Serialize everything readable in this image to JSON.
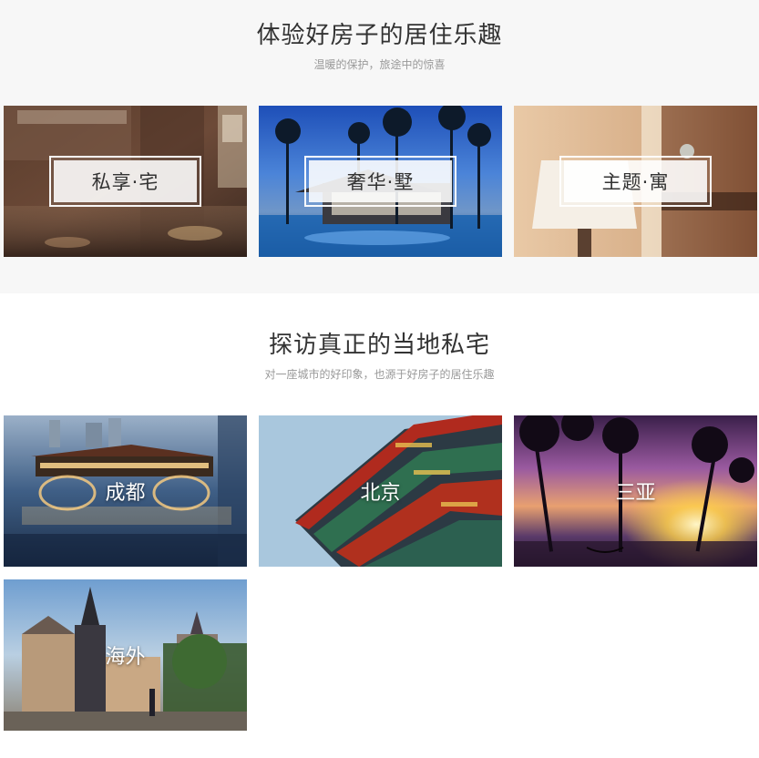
{
  "section_featured": {
    "title": "体验好房子的居住乐趣",
    "subtitle": "温暖的保护，旅途中的惊喜",
    "cards": [
      {
        "label": "私享·宅"
      },
      {
        "label": "奢华·墅"
      },
      {
        "label": "主题·寓"
      }
    ]
  },
  "section_cities": {
    "title": "探访真正的当地私宅",
    "subtitle": "对一座城市的好印象，也源于好房子的居住乐趣",
    "cities": [
      {
        "label": "成都"
      },
      {
        "label": "北京"
      },
      {
        "label": "三亚"
      },
      {
        "label": "海外"
      }
    ]
  },
  "colors": {
    "section1_bg": "#f7f7f7",
    "title": "#333333",
    "subtitle": "#999999"
  }
}
